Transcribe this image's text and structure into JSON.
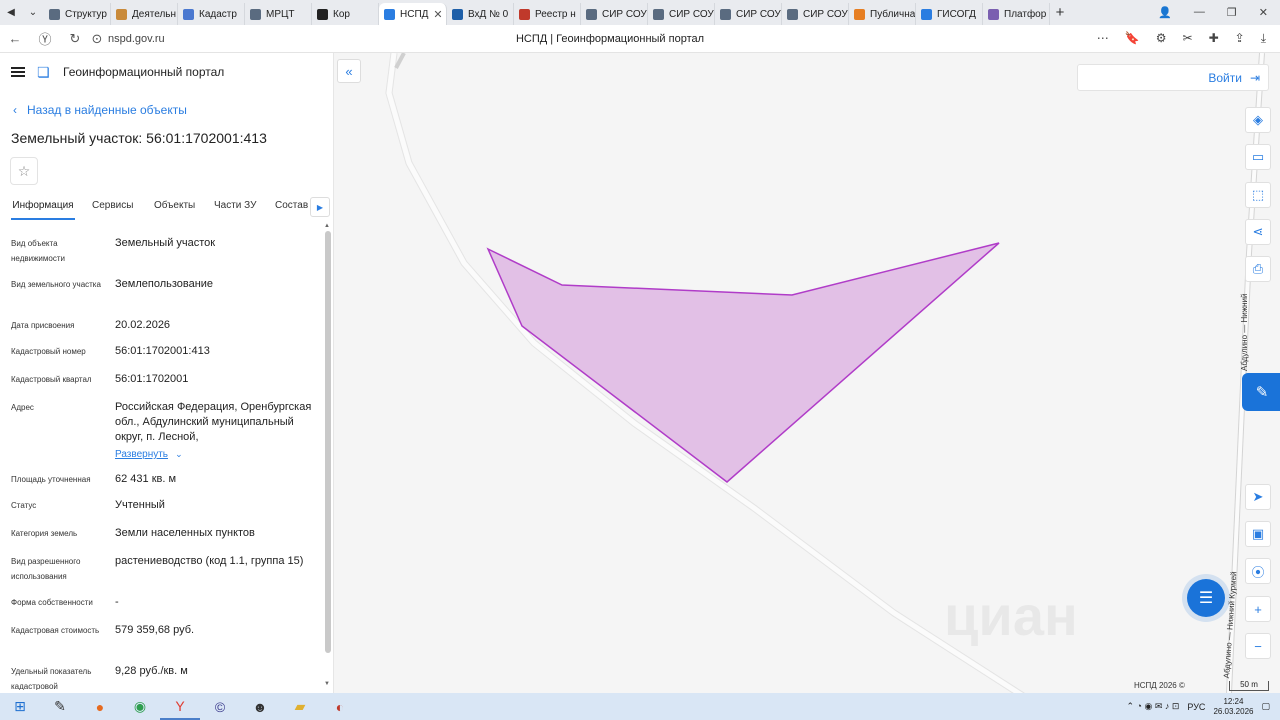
{
  "browser": {
    "tabs": [
      {
        "label": "Структур",
        "color": "#5a6b80"
      },
      {
        "label": "Деятельн",
        "color": "#c98a3a"
      },
      {
        "label": "Кадастр",
        "color": "#4a78d0"
      },
      {
        "label": "МРЦТ",
        "color": "#5a6b80"
      },
      {
        "label": "Кор",
        "color": "#222222"
      },
      {
        "label": "НСПД",
        "color": "#2a7de1",
        "active": true
      },
      {
        "label": "ВхД № 0",
        "color": "#1e5fa8"
      },
      {
        "label": "Реестр н",
        "color": "#c0392b"
      },
      {
        "label": "СИР СОУ",
        "color": "#5a6b80"
      },
      {
        "label": "СИР СОУ",
        "color": "#5a6b80"
      },
      {
        "label": "СИР СОУ",
        "color": "#5a6b80"
      },
      {
        "label": "СИР СОУ",
        "color": "#5a6b80"
      },
      {
        "label": "Публична",
        "color": "#e67e22"
      },
      {
        "label": "ГИСОГД",
        "color": "#2a7de1"
      },
      {
        "label": "Платфор",
        "color": "#7a5fb0"
      }
    ],
    "url": "nspd.gov.ru",
    "page_title": "НСПД | Геоинформационный портал"
  },
  "panel": {
    "portal_name": "Геоинформационный портал",
    "back_label": "Назад в найденные объекты",
    "object_title": "Земельный участок: 56:01:1702001:413",
    "tabs": [
      "Информация",
      "Сервисы",
      "Объекты",
      "Части ЗУ",
      "Состав"
    ],
    "properties": [
      {
        "label": "Вид объекта недвижимости",
        "value": "Земельный участок"
      },
      {
        "label": "Вид земельного участка",
        "value": "Землепользование"
      },
      {
        "label": "Дата присвоения",
        "value": "20.02.2026"
      },
      {
        "label": "Кадастровый номер",
        "value": "56:01:1702001:413"
      },
      {
        "label": "Кадастровый квартал",
        "value": "56:01:1702001"
      },
      {
        "label": "Адрес",
        "value": "Российская Федерация, Оренбургская обл., Абдулинский муниципальный округ, п. Лесной,"
      },
      {
        "label": "Площадь уточненная",
        "value": "62 431 кв. м"
      },
      {
        "label": "Статус",
        "value": "Учтенный"
      },
      {
        "label": "Категория земель",
        "value": "Земли населенных пунктов"
      },
      {
        "label": "Вид разрешенного использования",
        "value": "растениеводство (код 1.1, группа 15)"
      },
      {
        "label": "Форма собственности",
        "value": "-"
      },
      {
        "label": "Кадастровая стоимость",
        "value": "579 359,68 руб."
      },
      {
        "label": "Удельный показатель кадастровой",
        "value": "9,28 руб./кв. м"
      }
    ],
    "expand_label": "Развернуть"
  },
  "map": {
    "login_label": "Войти",
    "footer": "НСПД 2026 ©",
    "scale_label": "50 m",
    "road_label_1": "Абдулино — Нижний",
    "road_label_2": "Абдулино — Нижний Курмей",
    "parcel_fill": "#e2c0e6",
    "parcel_stroke": "#b03cc8",
    "watermark": "циан"
  },
  "taskbar": {
    "lang": "РУС",
    "time": "12:24",
    "date": "26.03.2026"
  }
}
